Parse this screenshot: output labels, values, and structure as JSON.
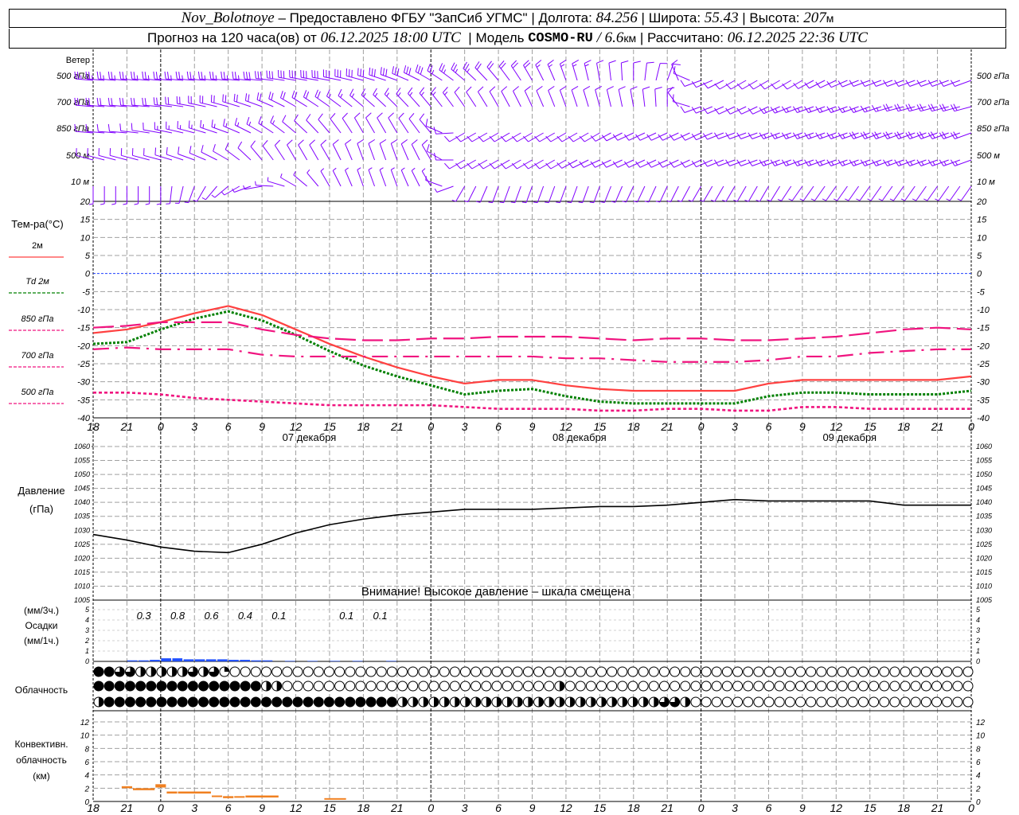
{
  "header": {
    "station": "Nov_Bolotnoye",
    "provider_text": " – Предоставлено ФГБУ \"ЗапСиб УГМС\" | ",
    "lon_label": "Долгота: ",
    "lon": "84.256",
    "lat_label": " | Широта: ",
    "lat": "55.43",
    "alt_label": " | Высота: ",
    "alt": "207",
    "alt_unit": "м",
    "forecast_text": "Прогноз на 120 часа(ов) от ",
    "forecast_from": "06.12.2025 18:00 UTC",
    "model_label": "  | Модель ",
    "model": "COSMO-RU",
    "resolution": " / 6.6",
    "res_unit": "км",
    "computed_label": " | Рассчитано: ",
    "computed": "06.12.2025 22:36 UTC"
  },
  "labels": {
    "wind": "Ветер",
    "temp": "Тем-ра(°C)",
    "pressure": "Давление",
    "pressure_unit": "(гПа)",
    "pressure_warning": "Внимание! Высокое давление – шкала смещена",
    "precip_3h": "(мм/3ч.)",
    "precip": "Осадки",
    "precip_1h": "(мм/1ч.)",
    "cloud": "Облачность",
    "conv1": "Конвективн.",
    "conv2": "облачность",
    "conv3": "(км)"
  },
  "colors": {
    "wind": "#8000ff",
    "t2m": "#ff4040",
    "td2m": "#008000",
    "upper": "#f0147f",
    "zero_line": "#2040ff",
    "pressure": "#000000",
    "precip": "#2050ff",
    "convective": "#f08020",
    "grid": "#a0a0a0"
  },
  "chart_data": {
    "x_ticks": [
      "18",
      "21",
      "0",
      "3",
      "6",
      "9",
      "12",
      "15",
      "18",
      "21",
      "0",
      "3",
      "6",
      "9",
      "12",
      "15",
      "18",
      "21",
      "0",
      "3",
      "6",
      "9",
      "12",
      "15",
      "18",
      "21",
      "0"
    ],
    "dates": [
      "07 декабря",
      "08 декабря",
      "09 декабря"
    ],
    "wind": {
      "type": "wind-barbs",
      "levels": [
        {
          "name": "500 гПа",
          "dir": [
            275,
            275,
            275,
            275,
            275,
            275,
            280,
            280,
            285,
            290,
            300,
            310,
            320,
            330,
            340,
            350,
            0,
            20,
            250,
            240,
            240,
            240,
            245,
            250,
            250,
            250,
            250
          ],
          "speed": [
            25,
            25,
            25,
            25,
            25,
            28,
            30,
            30,
            30,
            32,
            28,
            25,
            20,
            18,
            15,
            12,
            10,
            10,
            10,
            10,
            10,
            12,
            12,
            12,
            12,
            12,
            12
          ]
        },
        {
          "name": "700 гПа",
          "dir": [
            275,
            275,
            275,
            280,
            285,
            290,
            300,
            305,
            310,
            315,
            320,
            325,
            330,
            335,
            340,
            345,
            350,
            0,
            250,
            245,
            245,
            250,
            250,
            250,
            255,
            255,
            255
          ],
          "speed": [
            20,
            20,
            20,
            22,
            22,
            22,
            20,
            18,
            15,
            15,
            15,
            12,
            12,
            12,
            10,
            10,
            10,
            10,
            8,
            10,
            12,
            15,
            15,
            15,
            18,
            18,
            18
          ]
        },
        {
          "name": "850 гПа",
          "dir": [
            275,
            275,
            280,
            285,
            290,
            300,
            310,
            320,
            330,
            330,
            320,
            240,
            240,
            240,
            240,
            240,
            245,
            245,
            245,
            250,
            250,
            250,
            250,
            250,
            250,
            250,
            250
          ],
          "speed": [
            12,
            12,
            12,
            15,
            15,
            15,
            12,
            12,
            10,
            10,
            8,
            8,
            8,
            8,
            10,
            10,
            10,
            10,
            12,
            12,
            12,
            15,
            15,
            18,
            18,
            18,
            18
          ]
        },
        {
          "name": "500 м",
          "dir": [
            285,
            285,
            285,
            290,
            300,
            320,
            330,
            330,
            340,
            340,
            330,
            240,
            240,
            240,
            240,
            245,
            245,
            245,
            245,
            250,
            250,
            250,
            250,
            250,
            250,
            250,
            250
          ],
          "speed": [
            10,
            10,
            10,
            12,
            12,
            10,
            10,
            8,
            8,
            8,
            8,
            8,
            8,
            8,
            10,
            10,
            10,
            10,
            12,
            12,
            12,
            15,
            15,
            15,
            15,
            15,
            15
          ]
        },
        {
          "name": "10    м",
          "dir": [
            180,
            180,
            180,
            200,
            230,
            260,
            300,
            330,
            340,
            340,
            330,
            210,
            200,
            200,
            200,
            200,
            205,
            205,
            210,
            210,
            210,
            215,
            215,
            215,
            215,
            215,
            215
          ],
          "speed": [
            3,
            3,
            3,
            3,
            3,
            3,
            3,
            4,
            5,
            5,
            5,
            4,
            4,
            4,
            4,
            4,
            4,
            4,
            4,
            4,
            4,
            4,
            4,
            4,
            4,
            4,
            4
          ]
        }
      ]
    },
    "temperature": {
      "type": "line",
      "ylim": [
        -40,
        20
      ],
      "yticks": [
        20,
        15,
        10,
        5,
        0,
        -5,
        -10,
        -15,
        -20,
        -25,
        -30,
        -35,
        -40
      ],
      "series": [
        {
          "name": "2м",
          "style": "solid",
          "values": [
            -16.5,
            -15.5,
            -13.5,
            -11,
            -9,
            -11.5,
            -15.5,
            -19.5,
            -23,
            -26,
            -28.5,
            -30.5,
            -29.5,
            -29.5,
            -31,
            -32,
            -32.5,
            -32.5,
            -32.5,
            -32.5,
            -30.5,
            -29.5,
            -29.5,
            -29.5,
            -29.5,
            -29.5,
            -28.5
          ]
        },
        {
          "name": "Td 2м",
          "style": "dotted",
          "values": [
            -19.5,
            -19,
            -15.5,
            -12.5,
            -10.5,
            -13,
            -17,
            -21.5,
            -25.5,
            -28.5,
            -31,
            -33.5,
            -32.5,
            -32,
            -34,
            -35.5,
            -36,
            -36,
            -36,
            -36,
            -34,
            -33,
            -33,
            -33.5,
            -33.5,
            -33.5,
            -32.5
          ]
        },
        {
          "name": "850 гПа",
          "style": "dashed",
          "values": [
            -15,
            -14.5,
            -13.5,
            -13.5,
            -13.5,
            -15.5,
            -17,
            -18,
            -18.5,
            -18.5,
            -18,
            -18,
            -17.5,
            -17.5,
            -17.5,
            -18,
            -18.5,
            -18,
            -18,
            -18.5,
            -18.5,
            -18,
            -17.5,
            -16.5,
            -15.5,
            -15,
            -15.5
          ]
        },
        {
          "name": "700 гПа",
          "style": "dashdot",
          "values": [
            -21,
            -20.5,
            -21,
            -21,
            -21,
            -22.5,
            -23,
            -23,
            -23,
            -23,
            -23,
            -23,
            -23,
            -23,
            -23.5,
            -23.5,
            -24,
            -24.5,
            -24.5,
            -24.5,
            -24,
            -23,
            -23,
            -22,
            -21.5,
            -21,
            -21
          ]
        },
        {
          "name": "500 гПа",
          "style": "shortdash",
          "values": [
            -33,
            -33,
            -33.5,
            -34.5,
            -35,
            -35.5,
            -36,
            -36.5,
            -36.5,
            -36.5,
            -36.5,
            -37,
            -37.5,
            -37.5,
            -37.5,
            -38,
            -38,
            -37.5,
            -37.5,
            -38,
            -38,
            -37,
            -37,
            -37.5,
            -37.5,
            -37.5,
            -37.5
          ]
        }
      ]
    },
    "pressure": {
      "type": "line",
      "ylim": [
        1005,
        1060
      ],
      "yticks": [
        1060,
        1055,
        1050,
        1045,
        1040,
        1035,
        1030,
        1025,
        1020,
        1015,
        1010,
        1005
      ],
      "values": [
        1028.5,
        1026.5,
        1024,
        1022.5,
        1022,
        1025,
        1029,
        1032,
        1034,
        1035.5,
        1036.5,
        1037.5,
        1037.5,
        1037.5,
        1038,
        1038.5,
        1038.5,
        1039,
        1040,
        1041,
        1040.5,
        1040.5,
        1040.5,
        1040.5,
        1039,
        1039,
        1039
      ]
    },
    "precipitation": {
      "type": "bar",
      "ylim": [
        0,
        5
      ],
      "yticks": [
        5,
        4,
        3,
        2,
        1,
        0
      ],
      "hourly_mm": [
        0,
        0,
        0,
        0.1,
        0.1,
        0.15,
        0.3,
        0.3,
        0.2,
        0.2,
        0.2,
        0.2,
        0.15,
        0.15,
        0.1,
        0.1,
        0,
        0.05,
        0,
        0.05,
        0,
        0.05,
        0,
        0.05,
        0,
        0,
        0.05
      ],
      "sums_3h": [
        {
          "period": "21-0",
          "value": "0.3"
        },
        {
          "period": "0-3",
          "value": "0.8"
        },
        {
          "period": "3-6",
          "value": "0.6"
        },
        {
          "period": "6-9",
          "value": "0.4"
        },
        {
          "period": "9-12",
          "value": "0.1"
        },
        {
          "period": "15-18",
          "value": "0.1"
        },
        {
          "period": "18-21",
          "value": "0.1"
        }
      ]
    },
    "cloudiness": {
      "type": "symbols",
      "scale": "quarters (0-4)",
      "rows": [
        "443322222323100000000000000000000000000000000000000000000000000000000000000000000000",
        "444444444444444422000000000000000000000000002000000000000000000000000000000000000000",
        "244444444444444444444444444442222222222222222222222222332000000000000000000000000000"
      ]
    },
    "convective": {
      "type": "range-bars",
      "ylim": [
        0,
        12
      ],
      "yticks": [
        12,
        10,
        8,
        6,
        4,
        2,
        0
      ],
      "segments": [
        {
          "from": "20:30",
          "to": "21:30",
          "base_km": 2.0,
          "top_km": 2.3
        },
        {
          "from": "21:30",
          "to": "23:30",
          "base_km": 1.7,
          "top_km": 2.0
        },
        {
          "from": "23:30",
          "to": "00:30",
          "base_km": 2.1,
          "top_km": 2.6
        },
        {
          "from": "00:30",
          "to": "01:30",
          "base_km": 1.2,
          "top_km": 1.5
        },
        {
          "from": "01:30",
          "to": "04:30",
          "base_km": 1.2,
          "top_km": 1.5
        },
        {
          "from": "04:30",
          "to": "05:30",
          "base_km": 0.8,
          "top_km": 0.9
        },
        {
          "from": "05:30",
          "to": "06:30",
          "base_km": 0.5,
          "top_km": 0.8
        },
        {
          "from": "06:30",
          "to": "07:30",
          "base_km": 0.6,
          "top_km": 0.8
        },
        {
          "from": "07:30",
          "to": "10:30",
          "base_km": 0.6,
          "top_km": 0.9
        },
        {
          "from": "14:30",
          "to": "16:30",
          "base_km": 0.4,
          "top_km": 0.5
        }
      ]
    }
  }
}
